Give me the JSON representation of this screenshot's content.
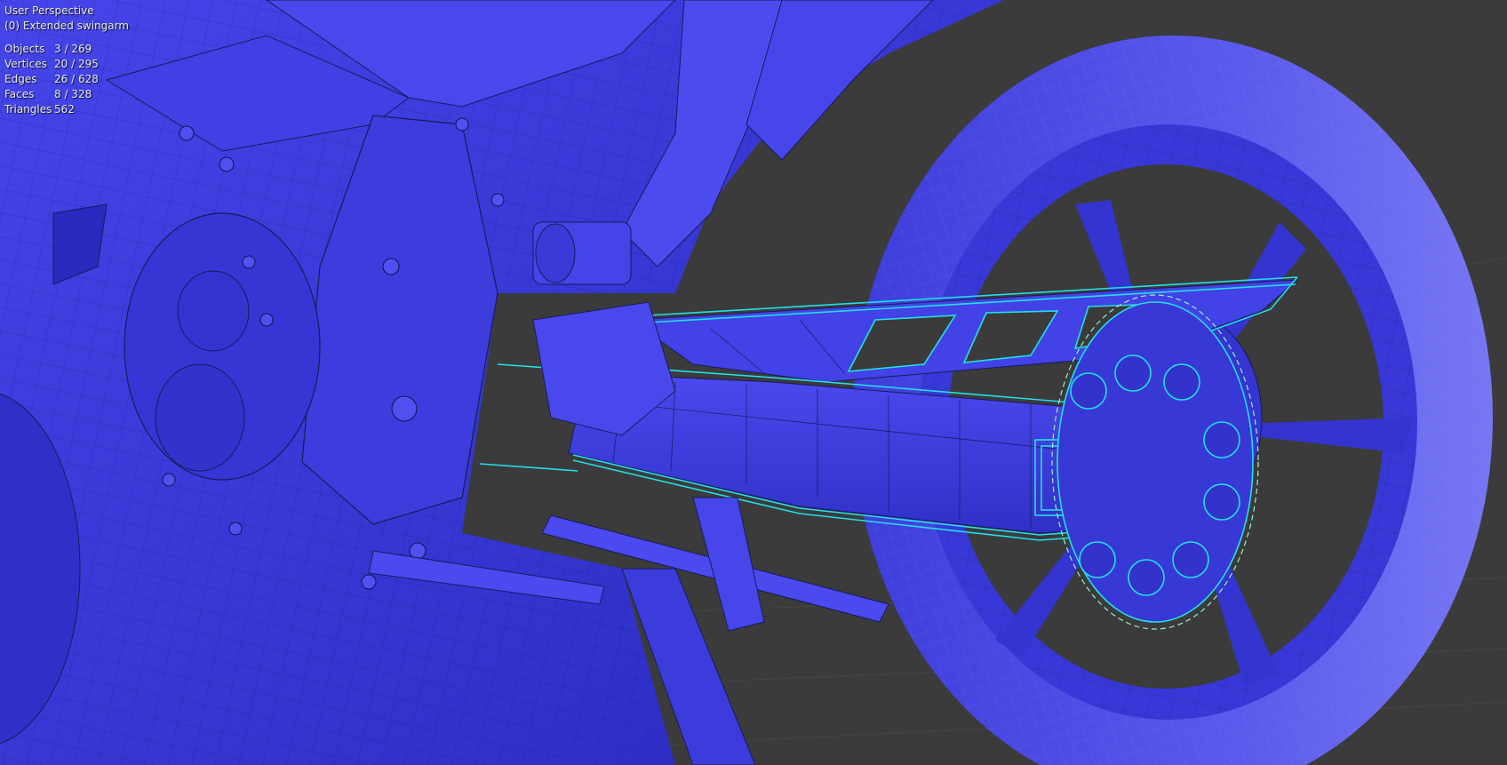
{
  "viewport": {
    "perspective_label": "User Perspective",
    "active_object_label": "(0) Extended swingarm"
  },
  "stats": [
    {
      "label": "Objects",
      "value": "3 / 269"
    },
    {
      "label": "Vertices",
      "value": "20 / 295"
    },
    {
      "label": "Edges",
      "value": "26 / 628"
    },
    {
      "label": "Faces",
      "value": "8 / 328"
    },
    {
      "label": "Triangles",
      "value": "562"
    }
  ],
  "colors": {
    "background": "#3b3b3b",
    "mesh_fill": "#3a3ae0",
    "mesh_light": "#6666f0",
    "mesh_dark": "#2626b0",
    "wire": "#1a1a5a",
    "selection_outline": "#22e0e8",
    "grid_line": "#4a4a4a"
  }
}
